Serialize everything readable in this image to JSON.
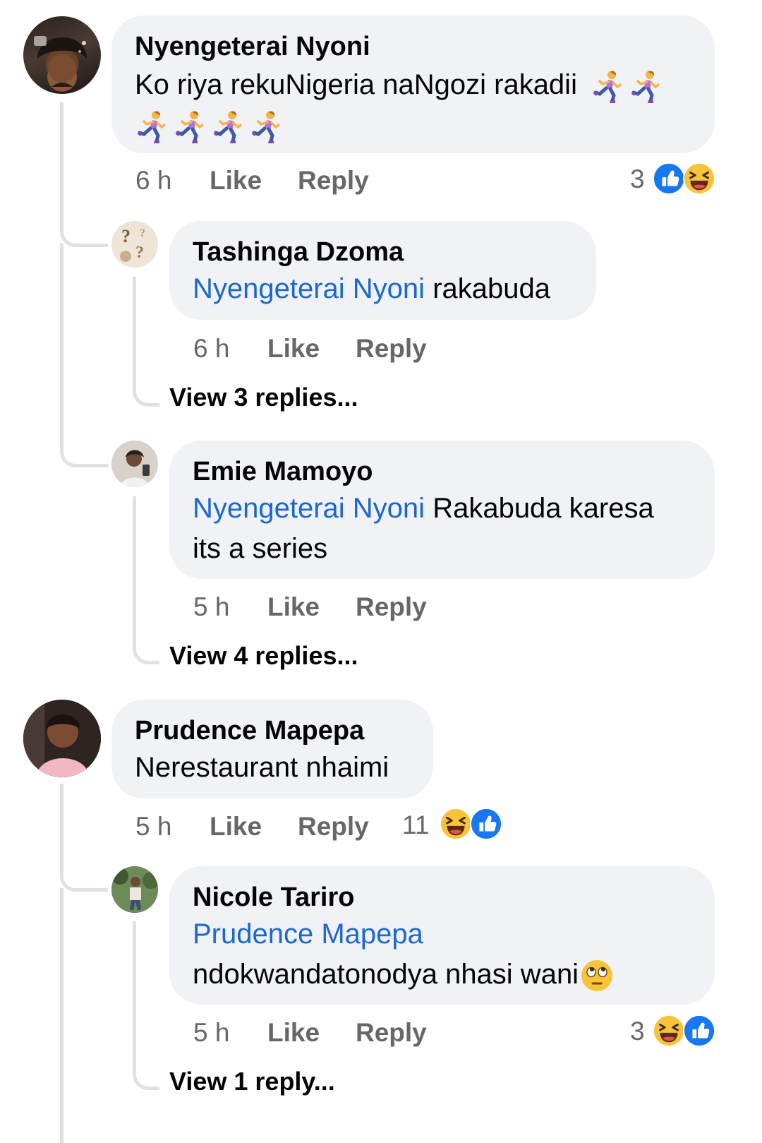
{
  "comments": [
    {
      "author": "Nyengeterai Nyoni",
      "text": "Ko riya rekuNigeria naNgozi rakadii",
      "emoji_name": "woman-running-emoji",
      "emoji_count": 6,
      "time": "6 h",
      "like": "Like",
      "reply": "Reply",
      "reaction_count": "3",
      "reactions": [
        "like-icon",
        "laughing-face-icon"
      ]
    },
    {
      "author": "Tashinga Dzoma",
      "mention": "Nyengeterai Nyoni",
      "text": "rakabuda",
      "time": "6 h",
      "like": "Like",
      "reply": "Reply",
      "view_replies": "View 3 replies..."
    },
    {
      "author": "Emie Mamoyo",
      "mention": "Nyengeterai Nyoni",
      "text_line1": "Rakabuda karesa",
      "text_line2": "its a series",
      "time": "5 h",
      "like": "Like",
      "reply": "Reply",
      "view_replies": "View 4 replies..."
    },
    {
      "author": "Prudence Mapepa",
      "text": "Nerestaurant nhaimi",
      "time": "5 h",
      "like": "Like",
      "reply": "Reply",
      "reaction_count": "11",
      "reactions": [
        "laughing-face-icon",
        "like-icon"
      ]
    },
    {
      "author": "Nicole Tariro",
      "mention": "Prudence Mapepa",
      "text": "ndokwandatonodya nhasi wani",
      "emoji_name": "face-with-rolling-eyes-emoji",
      "time": "5 h",
      "like": "Like",
      "reply": "Reply",
      "reaction_count": "3",
      "reactions": [
        "laughing-face-icon",
        "like-icon"
      ],
      "view_replies": "View 1 reply..."
    }
  ],
  "colors": {
    "bubble": "#f0f2f5",
    "mention": "#1b68d2",
    "meta": "#65676b",
    "thread_line": "#dfe1e5",
    "like_blue": "#1877f2",
    "laugh_yellow": "#f7c33a"
  }
}
